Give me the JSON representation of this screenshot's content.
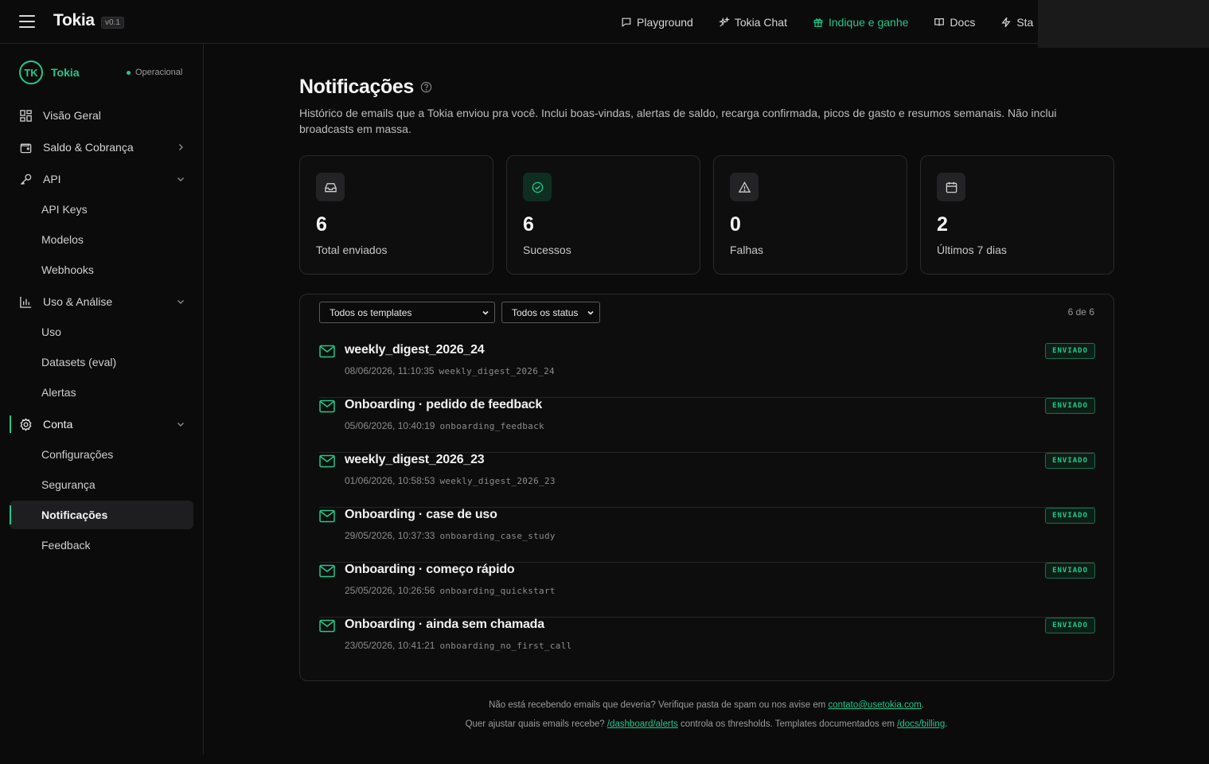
{
  "app": {
    "brand": "Tokia",
    "version": "v0.1"
  },
  "topnav": [
    {
      "label": "Playground",
      "icon": "chat-bubble-icon",
      "accent": false
    },
    {
      "label": "Tokia Chat",
      "icon": "sparkles-icon",
      "accent": false
    },
    {
      "label": "Indique e ganhe",
      "icon": "gift-icon",
      "accent": true
    },
    {
      "label": "Docs",
      "icon": "book-icon",
      "accent": false
    },
    {
      "label": "Sta",
      "icon": "bolt-icon",
      "accent": false
    }
  ],
  "sidebar": {
    "org": {
      "initials": "TK",
      "name": "Tokia",
      "status": "Operacional"
    },
    "items": {
      "overview": "Visão Geral",
      "billing": "Saldo & Cobrança",
      "api": "API",
      "api_keys": "API Keys",
      "models": "Modelos",
      "webhooks": "Webhooks",
      "usage_analysis": "Uso & Análise",
      "usage": "Uso",
      "datasets": "Datasets (eval)",
      "alerts": "Alertas",
      "account": "Conta",
      "settings": "Configurações",
      "security": "Segurança",
      "notifications": "Notificações",
      "feedback": "Feedback"
    }
  },
  "page": {
    "title": "Notificações",
    "description": "Histórico de emails que a Tokia enviou pra você. Inclui boas-vindas, alertas de saldo, recarga confirmada, picos de gasto e resumos semanais. Não inclui broadcasts em massa."
  },
  "stats": [
    {
      "value": "6",
      "label": "Total enviados",
      "icon": "inbox-icon"
    },
    {
      "value": "6",
      "label": "Sucessos",
      "icon": "check-circle-icon"
    },
    {
      "value": "0",
      "label": "Falhas",
      "icon": "warning-triangle-icon"
    },
    {
      "value": "2",
      "label": "Últimos 7 dias",
      "icon": "calendar-icon"
    }
  ],
  "filters": {
    "template": "Todos os templates",
    "status": "Todos os status",
    "count": "6 de 6"
  },
  "emails": [
    {
      "subject": "weekly_digest_2026_24",
      "date": "08/06/2026, 11:10:35",
      "template": "weekly_digest_2026_24",
      "status": "ENVIADO"
    },
    {
      "subject": "Onboarding · pedido de feedback",
      "date": "05/06/2026, 10:40:19",
      "template": "onboarding_feedback",
      "status": "ENVIADO"
    },
    {
      "subject": "weekly_digest_2026_23",
      "date": "01/06/2026, 10:58:53",
      "template": "weekly_digest_2026_23",
      "status": "ENVIADO"
    },
    {
      "subject": "Onboarding · case de uso",
      "date": "29/05/2026, 10:37:33",
      "template": "onboarding_case_study",
      "status": "ENVIADO"
    },
    {
      "subject": "Onboarding · começo rápido",
      "date": "25/05/2026, 10:26:56",
      "template": "onboarding_quickstart",
      "status": "ENVIADO"
    },
    {
      "subject": "Onboarding · ainda sem chamada",
      "date": "23/05/2026, 10:41:21",
      "template": "onboarding_no_first_call",
      "status": "ENVIADO"
    }
  ],
  "footer": {
    "line1_text": "Não está recebendo emails que deveria? Verifique pasta de spam ou nos avise em",
    "line1_link": "contato@usetokia.com",
    "line1_end": ".",
    "line2_a": "Quer ajustar quais emails recebe?",
    "line2_link1": "/dashboard/alerts",
    "line2_b": "controla os thresholds. Templates documentados em",
    "line2_link2": "/docs/billing",
    "line2_end": "."
  },
  "colors": {
    "accent": "#22c98a",
    "background": "#0b0b0c",
    "card_border": "#2a2a2c"
  }
}
